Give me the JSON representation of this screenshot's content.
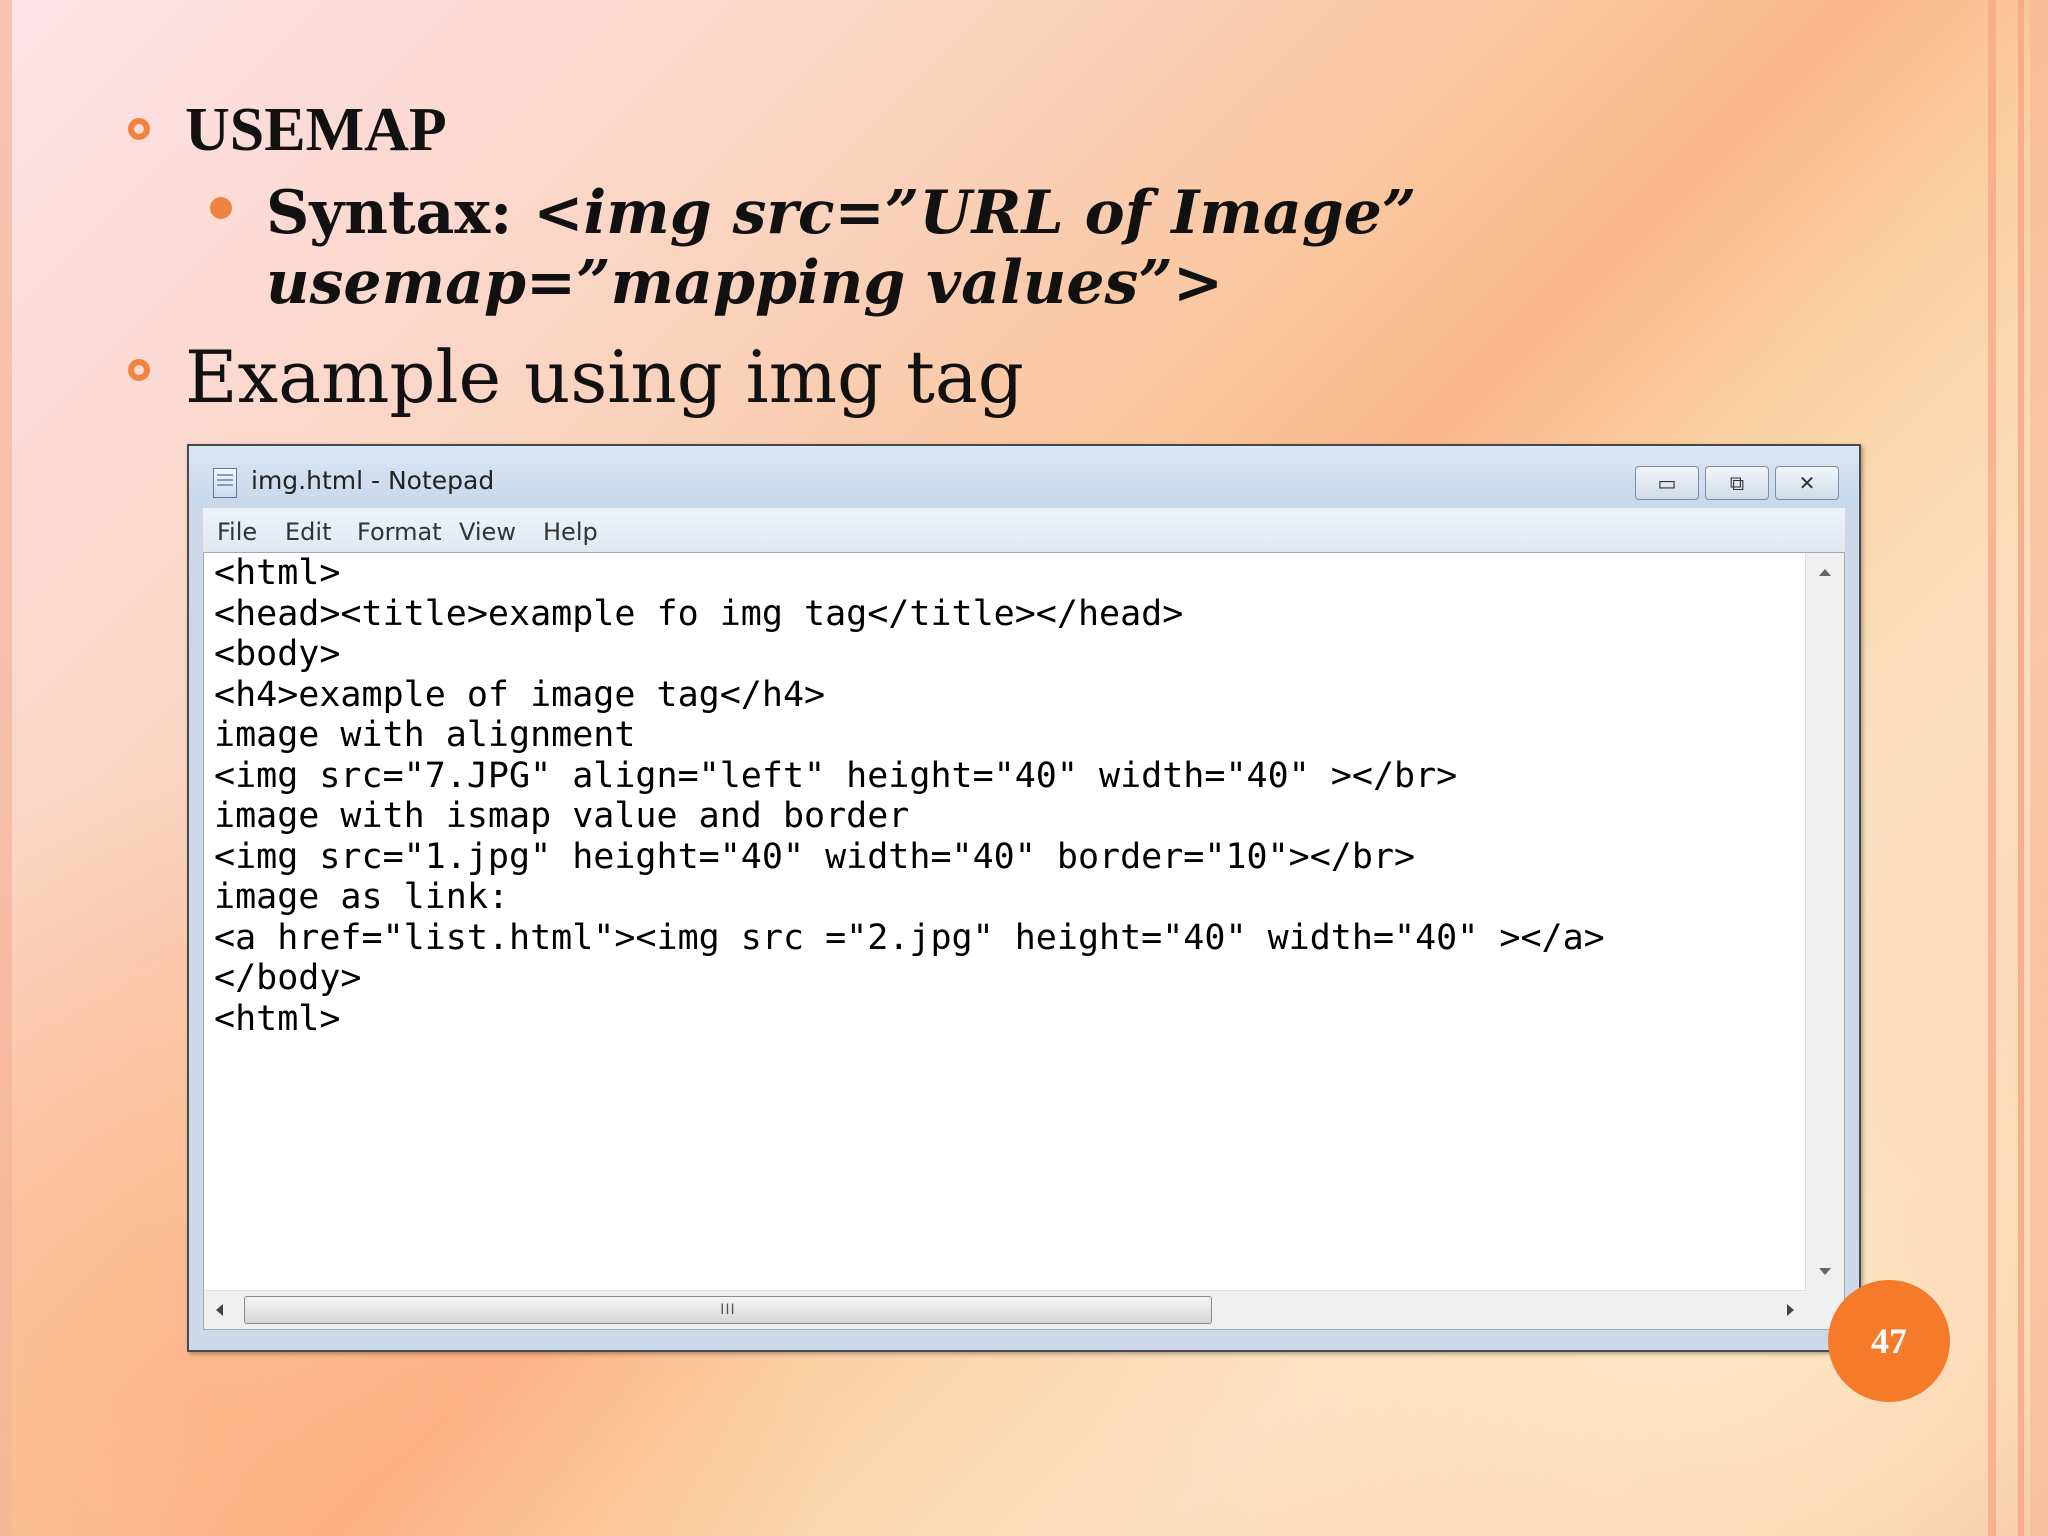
{
  "slide": {
    "heading": "USEMAP",
    "syntax_label": "Syntax: ",
    "syntax_code": "<img src=”URL of Image” usemap=”mapping values”>",
    "example_heading": "Example using img tag",
    "page_number": "47",
    "accent_color": "#f0843e"
  },
  "notepad": {
    "title": "img.html - Notepad",
    "buttons": {
      "minimize_icon": "minimize-icon",
      "maximize_icon": "maximize-icon",
      "close_icon": "close-icon",
      "minimize": "▭",
      "maximize": "⧉",
      "close": "✕"
    },
    "menu": {
      "file": "File",
      "edit": "Edit",
      "format": "Format",
      "view": "View",
      "help": "Help"
    },
    "content": "<html>\n<head><title>example fo img tag</title></head>\n<body>\n<h4>example of image tag</h4>\nimage with alignment\n<img src=\"7.JPG\" align=\"left\" height=\"40\" width=\"40\" ></br>\nimage with ismap value and border\n<img src=\"1.jpg\" height=\"40\" width=\"40\" border=\"10\"></br>\nimage as link:\n<a href=\"list.html\"><img src =\"2.jpg\" height=\"40\" width=\"40\" ></a>\n</body>\n<html>",
    "scroll_thumb_grip": "III",
    "resize_grip": ".::"
  }
}
